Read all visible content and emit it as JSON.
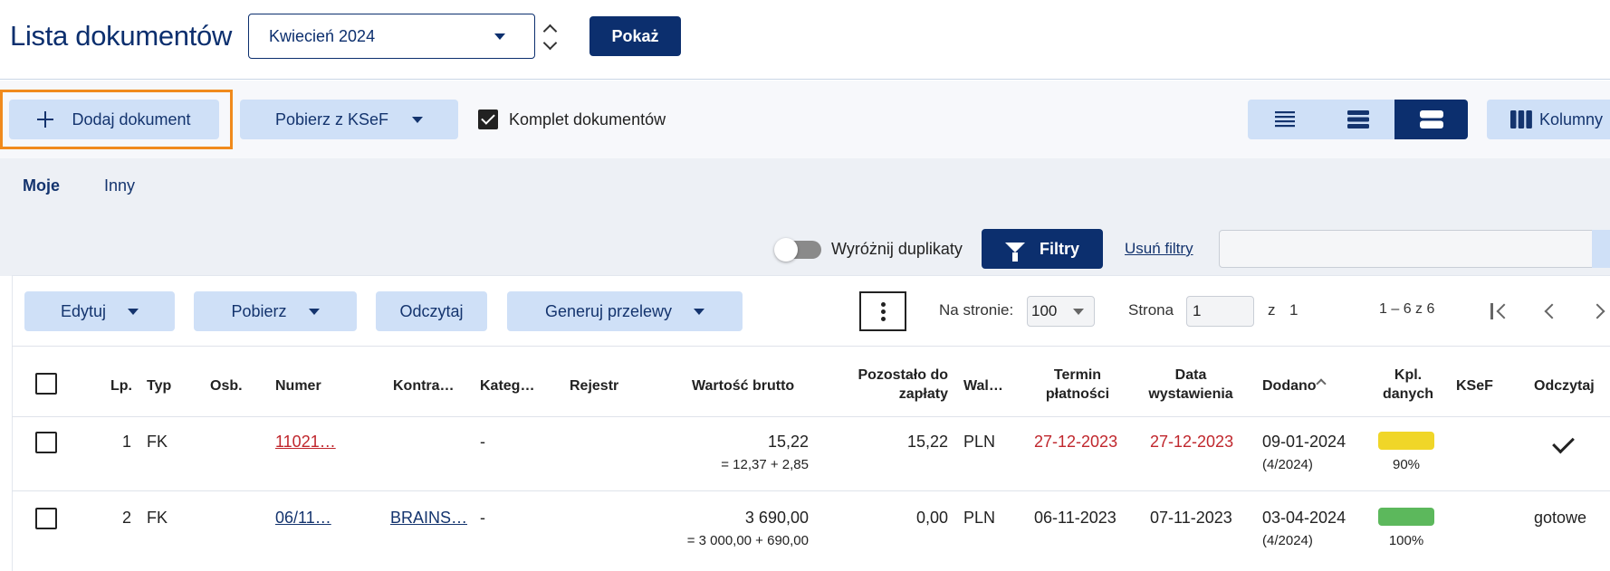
{
  "header": {
    "title": "Lista dokumentów",
    "month_value": "Kwiecień 2024",
    "show_button": "Pokaż"
  },
  "toolbar": {
    "add_document": "Dodaj dokument",
    "fetch_ksef": "Pobierz z KSeF",
    "complete_docs_label": "Komplet dokumentów",
    "complete_docs_checked": true,
    "columns_button": "Kolumny"
  },
  "tabs": [
    {
      "label": "Moje",
      "active": true
    },
    {
      "label": "Inny",
      "active": false
    }
  ],
  "filters": {
    "highlight_duplicates": "Wyróżnij duplikaty",
    "filters_button": "Filtry",
    "clear_filters": "Usuń filtry",
    "search_value": ""
  },
  "actions": {
    "edit": "Edytuj",
    "download": "Pobierz",
    "read": "Odczytaj",
    "generate_transfers": "Generuj przelewy"
  },
  "pagination": {
    "per_page_label": "Na stronie:",
    "per_page_value": "100",
    "page_label": "Strona",
    "page_value": "1",
    "of_label": "z",
    "total_pages": "1",
    "range_text": "1 – 6 z 6"
  },
  "table": {
    "headers": {
      "lp": "Lp.",
      "typ": "Typ",
      "osb": "Osb.",
      "numer": "Numer",
      "kontrahent": "Kontra…",
      "kategoria": "Kateg…",
      "rejestr": "Rejestr",
      "wartosc": "Wartość brutto",
      "pozostalo_1": "Pozostało do",
      "pozostalo_2": "zapłaty",
      "waluta": "Wal…",
      "termin_1": "Termin",
      "termin_2": "płatności",
      "data_1": "Data",
      "data_2": "wystawienia",
      "dodano": "Dodano",
      "kpl_1": "Kpl.",
      "kpl_2": "danych",
      "ksef": "KSeF",
      "odczytaj": "Odczytaj"
    },
    "rows": [
      {
        "lp": "1",
        "typ": "FK",
        "numer": "11021…",
        "kontrahent": "",
        "kategoria": "-",
        "wartosc": "15,22",
        "wartosc_detail": "= 12,37 + 2,85",
        "pozostalo": "15,22",
        "waluta": "PLN",
        "termin": "27-12-2023",
        "data": "27-12-2023",
        "dodano": "09-01-2024",
        "dodano_sub": "(4/2024)",
        "kpl_percent": "90%",
        "kpl_color": "#f0d628",
        "odczytaj": ""
      },
      {
        "lp": "2",
        "typ": "FK",
        "numer": "06/11…",
        "kontrahent": "BRAINS…",
        "kategoria": "-",
        "wartosc": "3 690,00",
        "wartosc_detail": "= 3 000,00 + 690,00",
        "pozostalo": "0,00",
        "waluta": "PLN",
        "termin": "06-11-2023",
        "data": "07-11-2023",
        "dodano": "03-04-2024",
        "dodano_sub": "(4/2024)",
        "kpl_percent": "100%",
        "kpl_color": "#5cb85c",
        "odczytaj": "gotowe"
      }
    ]
  },
  "icons": [
    "plus-icon",
    "caret-down-icon",
    "checkbox-icon",
    "list-dense-icon",
    "list-medium-icon",
    "list-large-icon",
    "columns-icon",
    "filter-icon",
    "more-vert-icon",
    "first-page-icon",
    "prev-page-icon",
    "next-page-icon",
    "sort-asc-icon",
    "check-icon"
  ],
  "colors": {
    "primary": "#0c2f6e",
    "light_button": "#cfe0f7",
    "highlight_border": "#f08a1c",
    "overdue": "#c0272d"
  }
}
